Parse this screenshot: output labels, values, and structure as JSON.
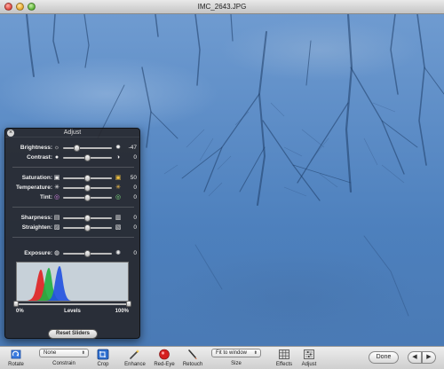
{
  "window": {
    "title": "IMC_2643.JPG"
  },
  "adjust_panel": {
    "title": "Adjust",
    "groups": [
      [
        {
          "label": "Brightness:",
          "value": "-47",
          "level": 0.28,
          "left_icon": "sun-small-icon",
          "right_icon": "sun-large-icon"
        },
        {
          "label": "Contrast:",
          "value": "0",
          "level": 0.5,
          "left_icon": "contrast-low-icon",
          "right_icon": "contrast-high-icon"
        }
      ],
      [
        {
          "label": "Saturation:",
          "value": "50",
          "level": 0.5,
          "left_icon": "saturation-low-icon",
          "right_icon": "saturation-high-icon"
        },
        {
          "label": "Temperature:",
          "value": "0",
          "level": 0.5,
          "left_icon": "cool-icon",
          "right_icon": "warm-icon"
        },
        {
          "label": "Tint:",
          "value": "0",
          "level": 0.5,
          "left_icon": "tint-magenta-icon",
          "right_icon": "tint-green-icon"
        }
      ],
      [
        {
          "label": "Sharpness:",
          "value": "0",
          "level": 0.5,
          "left_icon": "sharpness-low-icon",
          "right_icon": "sharpness-high-icon"
        },
        {
          "label": "Straighten:",
          "value": "0",
          "level": 0.5,
          "left_icon": "straighten-left-icon",
          "right_icon": "straighten-right-icon"
        }
      ],
      [
        {
          "label": "Exposure:",
          "value": "0",
          "level": 0.5,
          "left_icon": "exposure-low-icon",
          "right_icon": "exposure-high-icon"
        }
      ]
    ],
    "levels": {
      "label": "Levels",
      "min_label": "0%",
      "max_label": "100%",
      "black_point": 0.0,
      "white_point": 1.0
    },
    "reset_label": "Reset Sliders"
  },
  "toolbar": {
    "rotate": "Rotate",
    "constrain": {
      "selected": "None",
      "label": "Constrain"
    },
    "crop": "Crop",
    "enhance": "Enhance",
    "red_eye": "Red-Eye",
    "retouch": "Retouch",
    "size": {
      "selected": "Fit to window",
      "label": "Size"
    },
    "effects": "Effects",
    "adjust": "Adjust",
    "done": "Done"
  },
  "colors": {
    "photo_blue": "#5c8cc6",
    "panel_bg": "#26262a",
    "hist_red": "#e02020",
    "hist_green": "#20b040",
    "hist_blue": "#2050e0"
  }
}
